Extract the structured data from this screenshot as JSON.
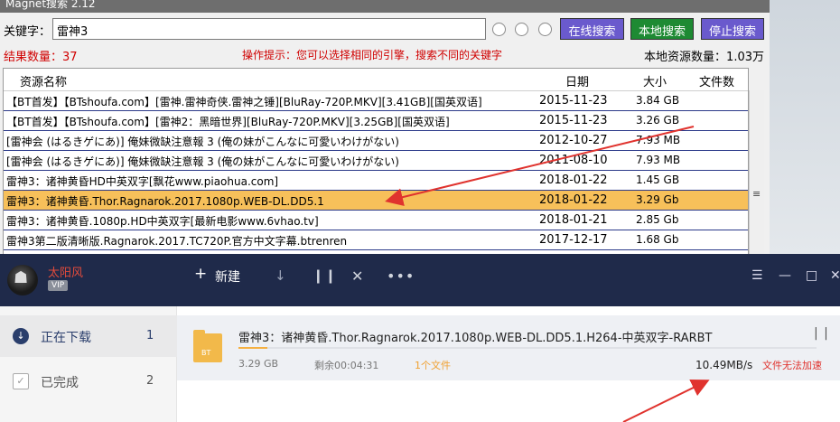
{
  "magnet": {
    "title": "Magnet搜索 2.12",
    "keyword_label": "关键字：",
    "keyword_value": "雷神3",
    "buttons": {
      "online": "在线搜索",
      "local": "本地搜索",
      "stop": "停止搜索"
    },
    "result_count": "结果数量：37",
    "hint": "操作提示：您可以选择相同的引擎，搜索不同的关键字",
    "local_count": "本地资源数量：1.03万",
    "columns": {
      "name": "资源名称",
      "date": "日期",
      "size": "大小",
      "files": "文件数"
    },
    "rows": [
      {
        "name": "【BT首发】【BTshoufa.com】[雷神.雷神奇侠.雷神之锤][BluRay-720P.MKV][3.41GB][国英双语]",
        "date": "2015-11-23",
        "size": "3.84 GB",
        "selected": false
      },
      {
        "name": "【BT首发】【BTshoufa.com】[雷神2：黑暗世界][BluRay-720P.MKV][3.25GB][国英双语]",
        "date": "2015-11-23",
        "size": "3.26 GB",
        "selected": false
      },
      {
        "name": "[雷神会 (はるきゲにあ)] 俺妹微缺注意報 3 (俺の妹がこんなに可愛いわけがない)",
        "date": "2012-10-27",
        "size": "7.93 MB",
        "selected": false
      },
      {
        "name": "[雷神会 (はるきゲにあ)] 俺妹微缺注意報 3 (俺の妹がこんなに可愛いわけがない)",
        "date": "2011-08-10",
        "size": "7.93 MB",
        "selected": false
      },
      {
        "name": "雷神3：诸神黄昏HD中英双字[飘花www.piaohua.com]",
        "date": "2018-01-22",
        "size": "1.45 GB",
        "selected": false
      },
      {
        "name": "雷神3：诸神黄昏.Thor.Ragnarok.2017.1080p.WEB-DL.DD5.1",
        "date": "2018-01-22",
        "size": "3.29 Gb",
        "selected": true
      },
      {
        "name": "雷神3：诸神黄昏.1080p.HD中英双字[最新电影www.6vhao.tv]",
        "date": "2018-01-21",
        "size": "2.85 Gb",
        "selected": false
      },
      {
        "name": "雷神3第二版清晰版.Ragnarok.2017.TC720P.官方中文字幕.btrenren",
        "date": "2017-12-17",
        "size": "1.68 Gb",
        "selected": false
      }
    ]
  },
  "downloader": {
    "username": "太阳风",
    "vip_badge": "VIP",
    "toolbar": {
      "new_label": "新建"
    },
    "nav": [
      {
        "label": "正在下载",
        "count": "1"
      },
      {
        "label": "已完成",
        "count": "2"
      }
    ],
    "task": {
      "name": "雷神3：诸神黄昏.Thor.Ragnarok.2017.1080p.WEB-DL.DD5.1.H264-中英双字-RARBT",
      "file_badge": "BT",
      "size": "3.29 GB",
      "remaining": "剩余00:04:31",
      "files": "1个文件",
      "speed": "10.49MB/s",
      "accel_note": "文件无法加速",
      "progress": 0.05
    }
  },
  "colors": {
    "selected_row": "#f7c05a",
    "online_button": "#6a5acd",
    "local_button": "#1e8a33",
    "arrow": "#e0332e",
    "downloader_header": "#1f2a4a"
  }
}
